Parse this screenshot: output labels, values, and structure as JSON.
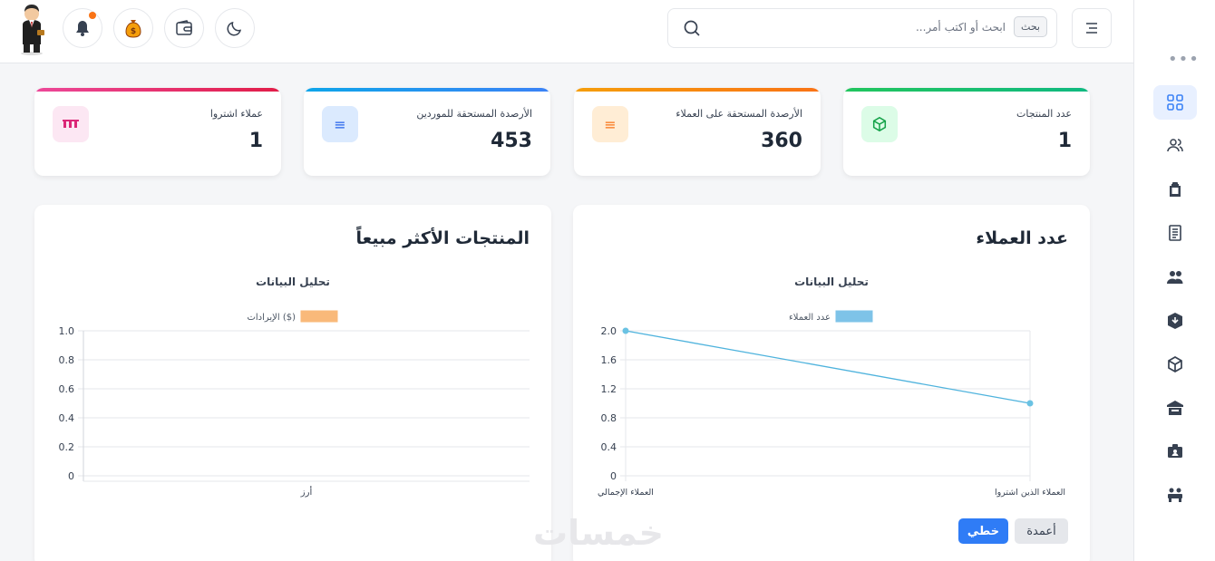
{
  "header": {
    "search_placeholder": "ابحث أو اكتب أمر...",
    "search_badge": "بحث"
  },
  "stats": [
    {
      "label": "عدد المنتجات",
      "value": "1",
      "accent": "#22c55e"
    },
    {
      "label": "الأرصدة المستحقة على العملاء",
      "value": "360",
      "accent": "#f59e0b"
    },
    {
      "label": "الأرصدة المستحقة للموردين",
      "value": "453",
      "accent": "#3b82f6"
    },
    {
      "label": "عملاء اشتروا",
      "value": "1",
      "accent": "#ec4899"
    }
  ],
  "customers_panel": {
    "title": "عدد العملاء",
    "toggle_columns": "أعمدة",
    "toggle_line": "خطي"
  },
  "products_panel": {
    "title": "المنتجات الأكثر مبيعاً"
  },
  "chart_data": [
    {
      "type": "line",
      "title": "تحليل البيانات",
      "categories": [
        "العملاء الإجمالي",
        "العملاء الذين اشتروا"
      ],
      "series": [
        {
          "name": "عدد العملاء",
          "values": [
            2,
            1
          ]
        }
      ],
      "ylim": [
        0,
        2
      ],
      "yticks": [
        "0",
        "0.4",
        "0.8",
        "1.2",
        "1.6",
        "2.0"
      ],
      "grid": true,
      "legend": "top",
      "color": "#7ec3e8"
    },
    {
      "type": "bar",
      "title": "تحليل البيانات",
      "categories": [
        "أرز"
      ],
      "series": [
        {
          "name": "الإيرادات ($)",
          "values": [
            0
          ]
        }
      ],
      "ylim": [
        0,
        1
      ],
      "yticks": [
        "0",
        "0.2",
        "0.4",
        "0.6",
        "0.8",
        "1.0"
      ],
      "grid": true,
      "legend": "top",
      "color": "#f9b97a"
    }
  ],
  "watermark": "خمسات"
}
